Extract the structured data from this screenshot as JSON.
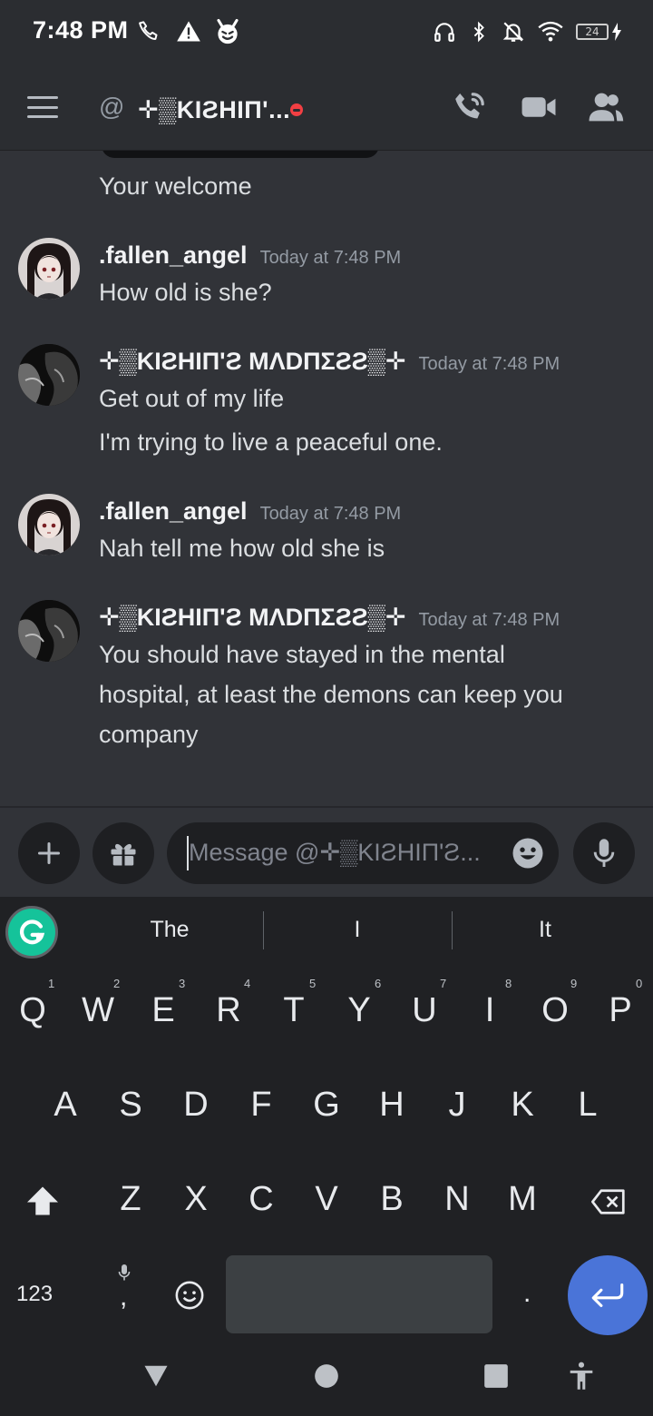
{
  "status_bar": {
    "time": "7:48 PM",
    "battery": "24"
  },
  "header": {
    "at_symbol": "@",
    "title": "✛▒KIƧHIП'..."
  },
  "messages": {
    "previous_line": "Your welcome",
    "groups": [
      {
        "author": ".fallen_angel",
        "timestamp": "Today at 7:48 PM",
        "lines": [
          "How old is she?"
        ]
      },
      {
        "author": "✛▒KIƧHIП'Ƨ MΛDПΣƧƧ▒✛",
        "timestamp": "Today at 7:48 PM",
        "lines": [
          "Get out of my life",
          "I'm trying to live a peaceful one."
        ]
      },
      {
        "author": ".fallen_angel",
        "timestamp": "Today at 7:48 PM",
        "lines": [
          "Nah tell me how old she is"
        ]
      },
      {
        "author": "✛▒KIƧHIП'Ƨ MΛDПΣƧƧ▒✛",
        "timestamp": "Today at 7:48 PM",
        "lines": [
          "You should have stayed in the mental",
          "hospital, at least the demons can keep you",
          "company"
        ]
      }
    ]
  },
  "composer": {
    "placeholder": "Message @✛▒KIƧHIП'Ƨ..."
  },
  "keyboard": {
    "suggestions": [
      "The",
      "I",
      "It"
    ],
    "row1": [
      "Q",
      "W",
      "E",
      "R",
      "T",
      "Y",
      "U",
      "I",
      "O",
      "P"
    ],
    "row1_numbers": [
      "1",
      "2",
      "3",
      "4",
      "5",
      "6",
      "7",
      "8",
      "9",
      "0"
    ],
    "row2": [
      "A",
      "S",
      "D",
      "F",
      "G",
      "H",
      "J",
      "K",
      "L"
    ],
    "row3": [
      "Z",
      "X",
      "C",
      "V",
      "B",
      "N",
      "M"
    ],
    "symbols_key": "123",
    "comma_key": ",",
    "period_key": "."
  },
  "colors": {
    "accent": "#4a74d8",
    "dnd": "#f23f43",
    "grammarly": "#15c39a"
  }
}
